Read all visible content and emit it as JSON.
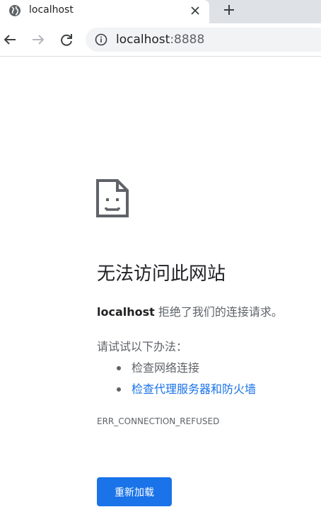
{
  "tab": {
    "title": "localhost",
    "favicon": "globe-icon",
    "close_icon": "close-icon"
  },
  "new_tab_icon": "plus-icon",
  "toolbar": {
    "back_icon": "arrow-left-icon",
    "forward_icon": "arrow-right-icon",
    "reload_icon": "reload-icon",
    "site_info_icon": "info-icon",
    "url_host": "localhost",
    "url_port": ":8888"
  },
  "error_page": {
    "icon": "broken-document-icon",
    "title": "无法访问此网站",
    "host": "localhost",
    "message": " 拒绝了我们的连接请求。",
    "try_label": "请试试以下办法：",
    "suggestions": [
      "检查网络连接",
      "检查代理服务器和防火墙"
    ],
    "error_code": "ERR_CONNECTION_REFUSED",
    "reload_label": "重新加载"
  },
  "colors": {
    "accent": "#1a73e8",
    "tabstrip": "#dee1e6",
    "omnibox": "#f1f3f4",
    "secondary_text": "#5f6368"
  }
}
